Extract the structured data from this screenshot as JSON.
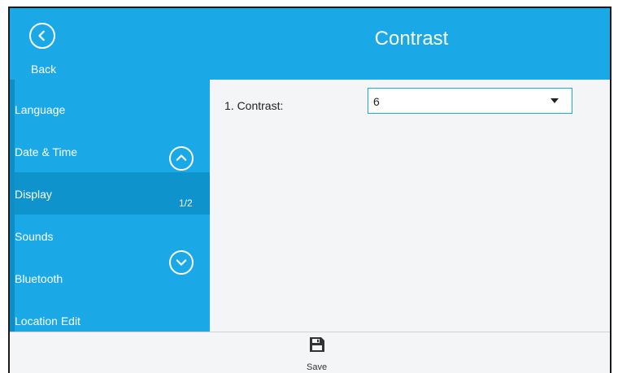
{
  "header": {
    "title": "Contrast",
    "back_label": "Back",
    "color": "#1aa9e6"
  },
  "sidebar": {
    "items": [
      {
        "label": "Language",
        "active": false
      },
      {
        "label": "Date & Time",
        "active": false
      },
      {
        "label": "Display",
        "active": true
      },
      {
        "label": "Sounds",
        "active": false
      },
      {
        "label": "Bluetooth",
        "active": false
      },
      {
        "label": "Location Edit",
        "active": false
      }
    ],
    "page_indicator": "1/2",
    "up_icon": "chevron-up-circle-icon",
    "down_icon": "chevron-down-circle-icon",
    "active_color": "#0e93cc"
  },
  "content": {
    "fields": [
      {
        "label": "1. Contrast:",
        "value": "6"
      }
    ]
  },
  "footer": {
    "save_label": "Save",
    "save_icon": "floppy-disk-icon"
  }
}
